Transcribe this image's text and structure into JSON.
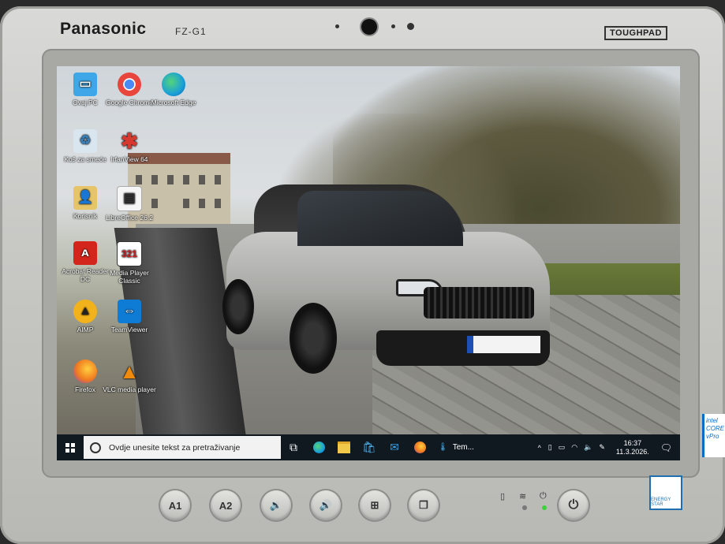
{
  "device": {
    "brand": "Panasonic",
    "model": "FZ-G1",
    "badge": "TOUGHPAD",
    "energy_label": "ENERGY STAR",
    "intel_label": "intel CORE vPro"
  },
  "desktop_icons": [
    {
      "id": "this-pc",
      "label": "Ovaj PC",
      "icon": "computer-icon",
      "color": "#3fa7e8"
    },
    {
      "id": "chrome",
      "label": "Google Chrome",
      "icon": "chrome-icon",
      "color": "#e8453c"
    },
    {
      "id": "edge",
      "label": "Microsoft Edge",
      "icon": "edge-icon",
      "color": "#1aa0d8"
    },
    {
      "id": "recycle",
      "label": "Koš za smeće",
      "icon": "recycle-bin-icon",
      "color": "#d9e6ef"
    },
    {
      "id": "irfan",
      "label": "IrfanView 64",
      "icon": "irfanview-icon",
      "color": "#d63a2f"
    },
    {
      "id": "user",
      "label": "Korisnik",
      "icon": "user-folder-icon",
      "color": "#e6c46a"
    },
    {
      "id": "libreoffice",
      "label": "LibreOffice 26.2",
      "icon": "libreoffice-icon",
      "color": "#f5f5f5"
    },
    {
      "id": "acrobat",
      "label": "Acrobat Reader DC",
      "icon": "acrobat-icon",
      "color": "#d4251c"
    },
    {
      "id": "mpc",
      "label": "Media Player Classic",
      "icon": "media-player-icon",
      "color": "#ffffff"
    },
    {
      "id": "aimp",
      "label": "AIMP",
      "icon": "aimp-icon",
      "color": "#f2b21b"
    },
    {
      "id": "teamviewer",
      "label": "TeamViewer",
      "icon": "teamviewer-icon",
      "color": "#0e7bd4"
    },
    {
      "id": "firefox",
      "label": "Firefox",
      "icon": "firefox-icon",
      "color": "#f07b1f"
    },
    {
      "id": "vlc",
      "label": "VLC media player",
      "icon": "vlc-icon",
      "color": "#f08a0c"
    }
  ],
  "taskbar": {
    "search_placeholder": "Ovdje unesite tekst za pretraživanje",
    "weather_label": "Tem...",
    "time": "16:37",
    "date": "11.3.2026."
  },
  "hardware_buttons": [
    "A1",
    "A2",
    "🔉",
    "🔊",
    "⊞",
    "❐"
  ],
  "colors": {
    "taskbar_bg": "#101820",
    "accent": "#1d4fb5"
  }
}
